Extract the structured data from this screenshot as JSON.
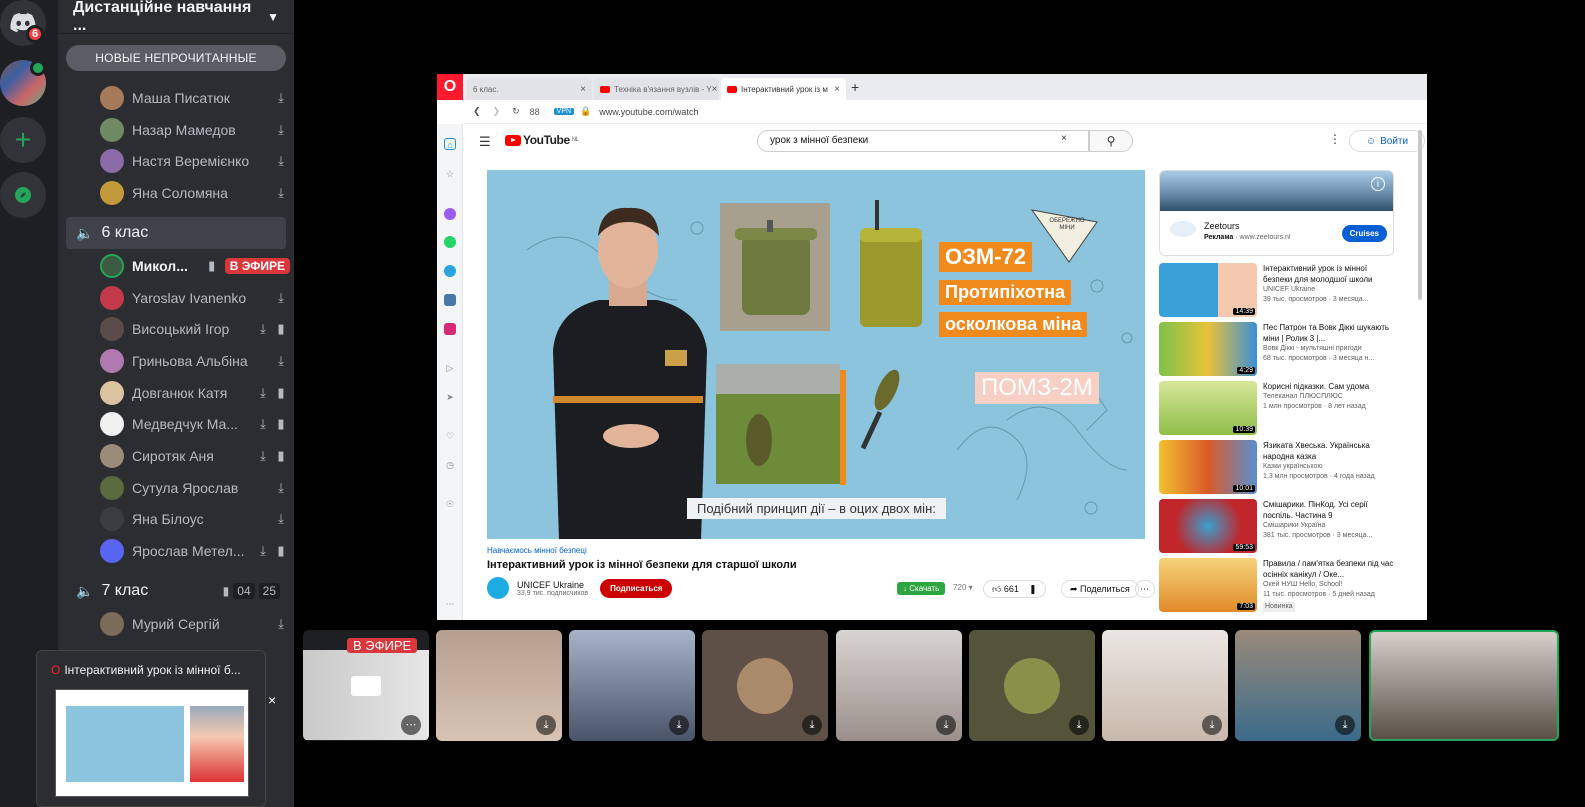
{
  "rail": {
    "badge_count": "6"
  },
  "server": {
    "name": "Дистанційне навчання ..."
  },
  "unread_pill": "НОВЫЕ НЕПРОЧИТАННЫЕ",
  "voice_users_top": [
    "Маша Писатюк",
    "Назар Мамедов",
    "Настя Веремієнко",
    "Яна Соломяна"
  ],
  "channel_6": {
    "name": "6 клас"
  },
  "channel_6_users": [
    "Микол...",
    "Yaroslav Ivanenko",
    "Висоцький Ігор",
    "Гриньова Альбіна",
    "Довганюк Катя",
    "Медведчук Ма...",
    "Сиротяк Аня",
    "Сутула Ярослав",
    "Яна Білоус",
    "Ярослав Метел..."
  ],
  "live_label": "В ЭФИРЕ",
  "channel_7": {
    "name": "7 клас",
    "count_a": "04",
    "count_b": "25"
  },
  "channel_7_users": [
    "Мурий Сергій"
  ],
  "browser": {
    "tabs": [
      "6 клас.",
      "Техніка в'язання вузлів - Y",
      "Інтерактивний урок із м"
    ],
    "addr_num": "88",
    "vpn": "VPN",
    "url": "www.youtube.com/watch"
  },
  "youtube": {
    "logo": "YouTube",
    "region": "NL",
    "search_value": "урок з мінної безпеки",
    "login": "Войти",
    "video": {
      "label1": "ОЗМ-72",
      "label2": "Протипіхотна",
      "label3": "осколкова міна",
      "label4": "ПОМЗ-2М",
      "caption": "Подібний принцип дії – в оцих двох мін:",
      "sign": "ОБЕРЕЖНО МІНИ"
    },
    "tag": "Навчаємось мінної безпеці",
    "title": "Інтерактивний урок із мінної безпеки для старшої школи",
    "channel": "UNICEF Ukraine",
    "subs": "33,9 тис. подписчиков",
    "subscribe": "Подписаться",
    "download": "Скачать",
    "quality": "720",
    "likes": "661",
    "share": "Поделиться",
    "ad": {
      "name": "Zeetours",
      "label": "Реклама",
      "domain": "www.zeetours.nl",
      "cta": "Cruises"
    },
    "recs": [
      {
        "title": "Інтерактивний урок із мінної безпеки для молодшої школи",
        "channel": "UNICEF Ukraine",
        "meta": "39 тыс. просмотров · 3 месяца...",
        "dur": "14:39"
      },
      {
        "title": "Пес Патрон та Вовк Діккі шукають міни | Ролик 3 |...",
        "channel": "Вовк Діккі - мультяшні пригоди",
        "meta": "68 тыс. просмотров · 3 месяца н...",
        "dur": "4:29"
      },
      {
        "title": "Корисні підказки. Сам удома",
        "channel": "Телеканал ПЛЮСПЛЮС",
        "meta": "1 млн просмотров · 8 лет назад",
        "dur": "10:39"
      },
      {
        "title": "Язиката Хвеська. Українська народна казка",
        "channel": "Казки українською",
        "meta": "1,3 млн просмотров · 4 года назад",
        "dur": "10:01"
      },
      {
        "title": "Смішарики. ПінКод. Усі серії поспіль. Частина 9",
        "channel": "Смішарики Україна",
        "meta": "381 тыс. просмотров · 3 месяца...",
        "dur": "59:53"
      },
      {
        "title": "Правила / пам'ятка безпеки під час осінніх канікул / Оке...",
        "channel": "Окей НУШ Hello, School!",
        "meta": "11 тыс. просмотров · 5 дней назад",
        "dur": "7:03",
        "badge": "Новинка"
      }
    ]
  },
  "popup": {
    "title": "Інтерактивний урок із мінної б..."
  },
  "strip_live": "В ЭФИРЕ",
  "colors": {
    "blurple": "#5865f2",
    "green": "#23a55a",
    "red": "#da373c",
    "yt_red": "#ff0000",
    "orange": "#f08a1c"
  }
}
